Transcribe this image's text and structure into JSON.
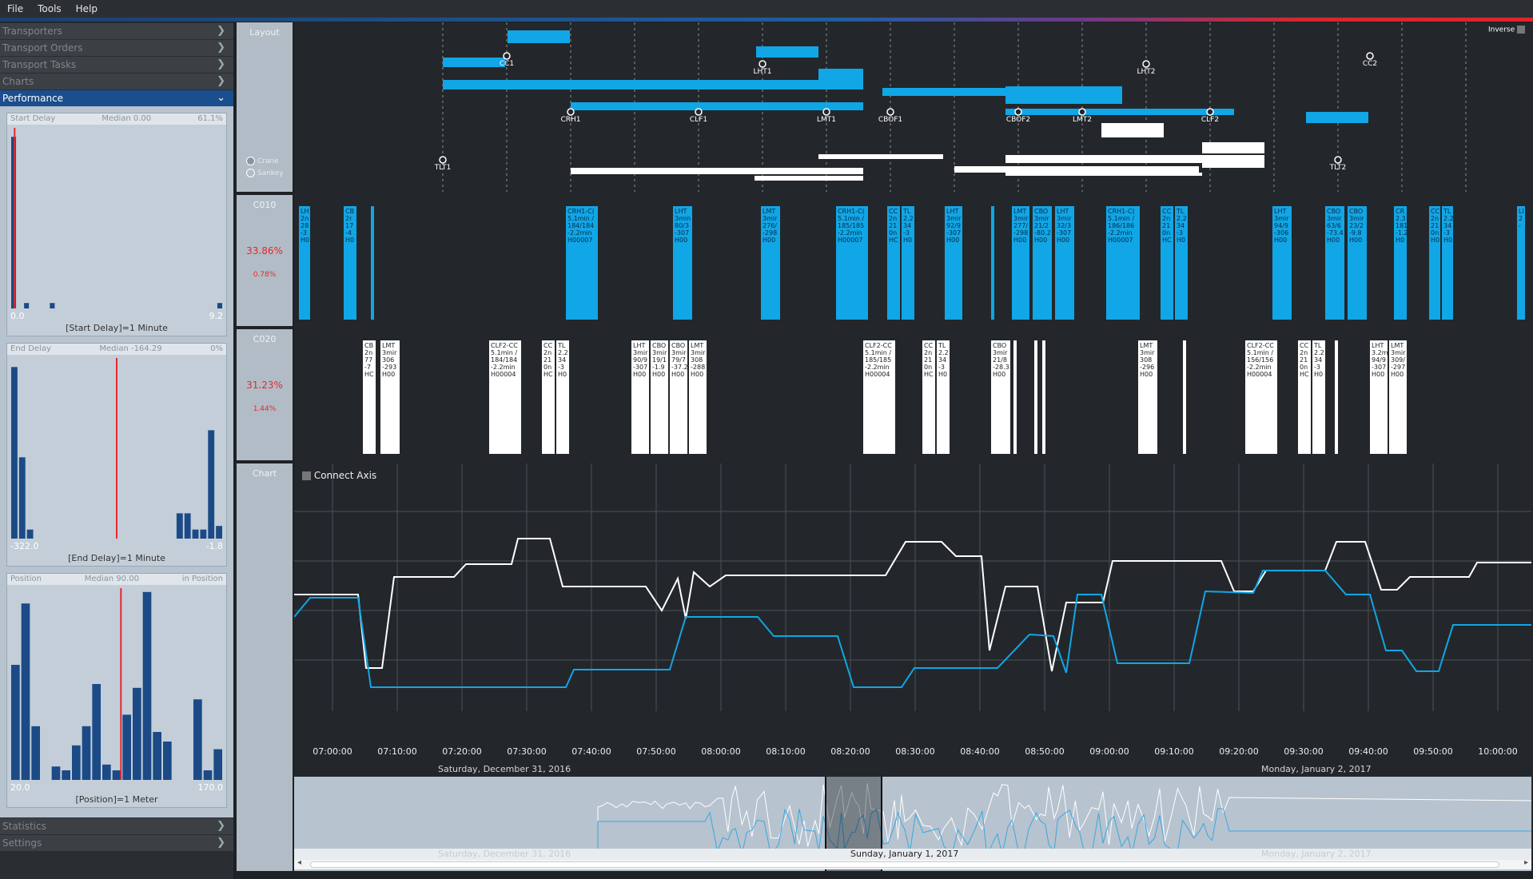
{
  "menu": [
    "File",
    "Tools",
    "Help"
  ],
  "sidebar": {
    "sections_top": [
      "Transporters",
      "Transport Orders",
      "Transport Tasks",
      "Charts"
    ],
    "performance": "Performance",
    "sections_bottom": [
      "Statistics",
      "Settings"
    ]
  },
  "histograms": [
    {
      "title": "Start Delay",
      "median": "Median 0.00",
      "extra": "61.1%",
      "min": "0.0",
      "max": "9.2",
      "caption": "[Start Delay]=1 Minute",
      "marker": 0.02,
      "bars": [
        0.95,
        0,
        0.03,
        0,
        0,
        0,
        0.03,
        0,
        0,
        0,
        0,
        0,
        0,
        0,
        0,
        0,
        0,
        0,
        0,
        0,
        0,
        0,
        0,
        0,
        0,
        0,
        0,
        0,
        0,
        0,
        0,
        0,
        0.03
      ]
    },
    {
      "title": "End Delay",
      "median": "Median -164.29",
      "extra": "0%",
      "min": "-322.0",
      "max": "-1.8",
      "caption": "[End Delay]=1 Minute",
      "marker": 0.5,
      "bars": [
        0.95,
        0.45,
        0.05,
        0,
        0,
        0,
        0,
        0,
        0,
        0,
        0,
        0,
        0,
        0,
        0,
        0,
        0,
        0,
        0,
        0,
        0,
        0.14,
        0.14,
        0.05,
        0.05,
        0.6,
        0.07
      ]
    },
    {
      "title": "Position",
      "median": "Median 90.00",
      "extra": "in Position",
      "min": "20.0",
      "max": "170.0",
      "caption": "[Position]=1 Meter",
      "marker": 0.52,
      "bars": [
        0.6,
        0.92,
        0.28,
        0,
        0.07,
        0.05,
        0.18,
        0.28,
        0.5,
        0.08,
        0.05,
        0.34,
        0.48,
        0.98,
        0.25,
        0.2,
        0,
        0,
        0.42,
        0.05,
        0.16
      ]
    }
  ],
  "mid_labels": {
    "layout": "Layout",
    "c010": "C010",
    "c020": "C020",
    "chart": "Chart"
  },
  "radio": {
    "crane": "Crane",
    "sankey": "Sankey"
  },
  "inverse": "Inverse",
  "c010": {
    "util": "33.86%",
    "sub": "0.78%"
  },
  "c020": {
    "util": "31.23%",
    "sub": "1.44%"
  },
  "connect_axis": "Connect Axis",
  "time_ticks": [
    "07:00:00",
    "07:10:00",
    "07:20:00",
    "07:30:00",
    "07:40:00",
    "07:50:00",
    "08:00:00",
    "08:10:00",
    "08:20:00",
    "08:30:00",
    "08:40:00",
    "08:50:00",
    "09:00:00",
    "09:10:00",
    "09:20:00",
    "09:30:00",
    "09:40:00",
    "09:50:00",
    "10:00:00"
  ],
  "days": {
    "d1": "Saturday, December 31, 2016",
    "d2": "Monday, January 2, 2017",
    "d3": "Sunday, January 1, 2017"
  },
  "layout_nodes": [
    "CC1",
    "LHT1",
    "LHT2",
    "CC2",
    "CRH1",
    "CLF1",
    "LMT1",
    "CBOF1",
    "CBOF2",
    "LMT2",
    "CLF2",
    "TLT1",
    "TLT2"
  ],
  "c010_bars": [
    [
      "LH\n2n\n28\n-3\nH0",
      "b"
    ],
    [
      "CB\n2r\n17\n-4\nH0",
      "b"
    ],
    [
      "",
      "b"
    ],
    [
      "CRH1-C(\n5.1min /\n184/184\n-2.2min\nH00007",
      "b"
    ],
    [
      "LHT\n3min\n80/3\n-307\nH00",
      "b"
    ],
    [
      "LMT\n3mir\n276/\n-298\nH00",
      "b"
    ],
    [
      "CRH1-C(\n5.1min /\n185/185\n-2.2min\nH00007",
      "b"
    ],
    [
      "CC\n2n\n21\n0n\nHC",
      "b"
    ],
    [
      "TL\n2.2\n34\n-3\nH0",
      "b"
    ],
    [
      "LHT\n3mir\n92/9\n-307\nH00",
      "b"
    ],
    [
      "",
      "b"
    ],
    [
      "LMT\n3mir\n277/\n-298\nH00",
      "b"
    ],
    [
      "CBO\n3mir\n21/2\n-80.2\nH00",
      "b"
    ],
    [
      "LHT\n3mir\n32/3\n-307\nH00",
      "b"
    ],
    [
      "CRH1-C(\n5.1min /\n186/186\n-2.2min\nH00007",
      "b"
    ],
    [
      "CC\n2n\n21\n0n\nHC",
      "b"
    ],
    [
      "TL\n2.2\n34\n-3\nH0",
      "b"
    ],
    [
      "LHT\n3mir\n94/9\n-306\nH00",
      "b"
    ],
    [
      "CBO\n3mir\n63/6\n-73.4\nH00",
      "b"
    ],
    [
      "CBO\n3mir\n23/2\n-9.8\nH00",
      "b"
    ],
    [
      "CR\n2.3\n181\n-1.2\nH0",
      "b"
    ],
    [
      "CC\n2n\n21\n0n\nH0",
      "b"
    ],
    [
      "TL\n2.2\n34\n-3\nH0",
      "b"
    ],
    [
      "LI\n2\n-",
      "b"
    ]
  ],
  "c020_bars": [
    [
      "CB\n2n\n77\n-7\nHC",
      "w"
    ],
    [
      "LMT\n3mir\n306\n-293\nH00",
      "w"
    ],
    [
      "CLF2-CC\n5.1min /\n184/184\n-2.2min\nH00004",
      "w"
    ],
    [
      "CC\n2n\n21\n0n\nHC",
      "w"
    ],
    [
      "TL\n2.2\n34\n-3\nH0",
      "w"
    ],
    [
      "LHT\n3mir\n90/9\n-307\nH00",
      "w"
    ],
    [
      "CBO\n3mir\n19/1\n-1.9\nH00",
      "w"
    ],
    [
      "CBO\n3mir\n79/7\n-37.2\nH00",
      "w"
    ],
    [
      "LMT\n3mir\n308\n-288\nH00",
      "w"
    ],
    [
      "CLF2-CC\n5.1min /\n185/185\n-2.2min\nH00004",
      "w"
    ],
    [
      "CC\n2n\n21\n0n\nHC",
      "w"
    ],
    [
      "TL\n2.2\n34\n-3\nH0",
      "w"
    ],
    [
      "CBO\n3mir\n21/8\n-28.3\nH00",
      "w"
    ],
    [
      "",
      "w"
    ],
    [
      "",
      "w"
    ],
    [
      "",
      "w"
    ],
    [
      "LMT\n3mir\n308\n-296\nH00",
      "w"
    ],
    [
      "",
      "w"
    ],
    [
      "CLF2-CC\n5.1min /\n156/156\n-2.2min\nH00004",
      "w"
    ],
    [
      "CC\n2n\n21\n0n\nHC",
      "w"
    ],
    [
      "TL\n2.2\n34\n-3\nH0",
      "w"
    ],
    [
      "",
      "w"
    ],
    [
      "LHT\n3.2mi\n94/9\n-307\nH00",
      "w"
    ],
    [
      "LMT\n3mir\n309/\n-297\nH00",
      "w"
    ]
  ],
  "colors": {
    "blue": "#11a6e6",
    "white": "#ffffff",
    "accent": "#1a4e8c"
  }
}
